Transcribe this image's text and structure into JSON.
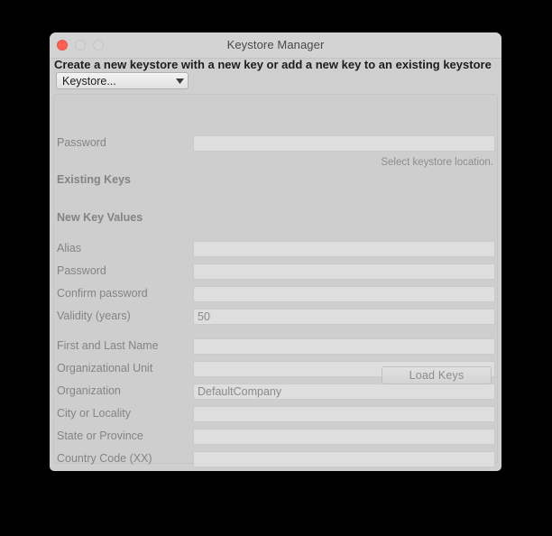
{
  "window": {
    "title": "Keystore Manager",
    "traffic_lights": [
      "close",
      "minimize",
      "zoom"
    ]
  },
  "headline": "Create a new keystore with a new key or add a new key to an existing keystore",
  "keystore_select": {
    "value": "Keystore...",
    "icon": "chevron-down-icon"
  },
  "keystore_section": {
    "password_label": "Password",
    "password_value": "",
    "hint": "Select keystore location."
  },
  "existing_keys": {
    "heading": "Existing Keys"
  },
  "new_key_values": {
    "heading": "New Key Values",
    "fields": [
      {
        "label": "Alias",
        "value": ""
      },
      {
        "label": "Password",
        "value": ""
      },
      {
        "label": "Confirm password",
        "value": ""
      },
      {
        "label": "Validity (years)",
        "value": "50"
      },
      {
        "label": "First and Last Name",
        "value": ""
      },
      {
        "label": "Organizational Unit",
        "value": ""
      },
      {
        "label": "Organization",
        "value": "DefaultCompany"
      },
      {
        "label": "City or Locality",
        "value": ""
      },
      {
        "label": "State or Province",
        "value": ""
      },
      {
        "label": "Country Code (XX)",
        "value": ""
      }
    ]
  },
  "footer": {
    "load_keys_label": "Load Keys"
  },
  "colors": {
    "window_bg": "#cfcfcf",
    "panel_bg": "#cecece",
    "field_bg": "#dedede",
    "label_text": "#848484",
    "close_light": "#ff6054"
  }
}
